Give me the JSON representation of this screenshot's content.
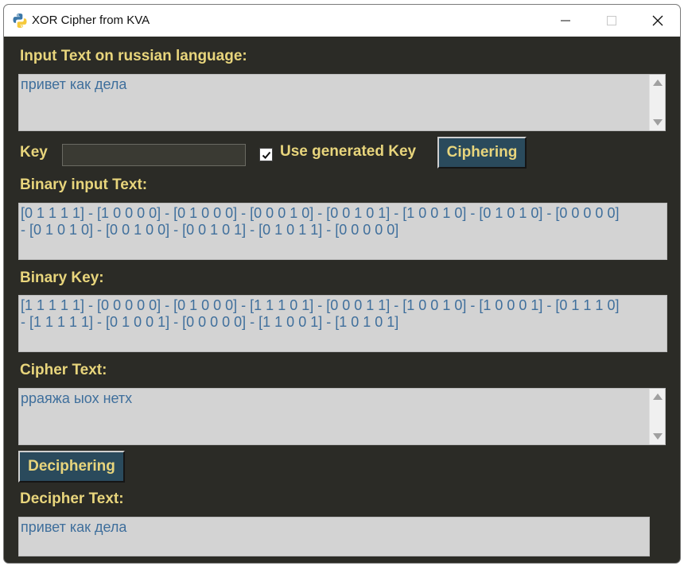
{
  "window": {
    "title": "XOR Cipher from KVA"
  },
  "input": {
    "label": "Input Text on russian language:",
    "value": "привет как дела"
  },
  "key": {
    "label": "Key",
    "value": "",
    "use_generated_label": "Use generated Key",
    "use_generated_checked": true,
    "cipher_button": "Ciphering"
  },
  "binary_input": {
    "label": "Binary input Text:",
    "line1": "[0 1 1 1 1] - [1 0 0 0 0] - [0 1 0 0 0] - [0 0 0 1 0] - [0 0 1 0 1] - [1 0 0 1 0] - [0 1 0 1 0] - [0 0 0 0 0]",
    "line2": "- [0 1 0 1 0] - [0 0 1 0 0] - [0 0 1 0 1] - [0 1 0 1 1] - [0 0 0 0 0]"
  },
  "binary_key": {
    "label": "Binary Key:",
    "line1": "[1 1 1 1 1] - [0 0 0 0 0] - [0 1 0 0 0] - [1 1 1 0 1] - [0 0 0 1 1] - [1 0 0 1 0] - [1 0 0 0 1] - [0 1 1 1 0]",
    "line2": "- [1 1 1 1 1] - [0 1 0 0 1] - [0 0 0 0 0] - [1 1 0 0 1] - [1 0 1 0 1]"
  },
  "cipher": {
    "label": "Cipher Text:",
    "value": "рраяжа ыох нетх",
    "decipher_button": "Deciphering"
  },
  "decipher": {
    "label": "Decipher Text:",
    "value": "привет как дела"
  },
  "colors": {
    "background": "#2b2b26",
    "label": "#e8d57c",
    "textbox_bg": "#d3d3d3",
    "textbox_text": "#3f6f9c",
    "button_bg": "#2a4a5c"
  }
}
